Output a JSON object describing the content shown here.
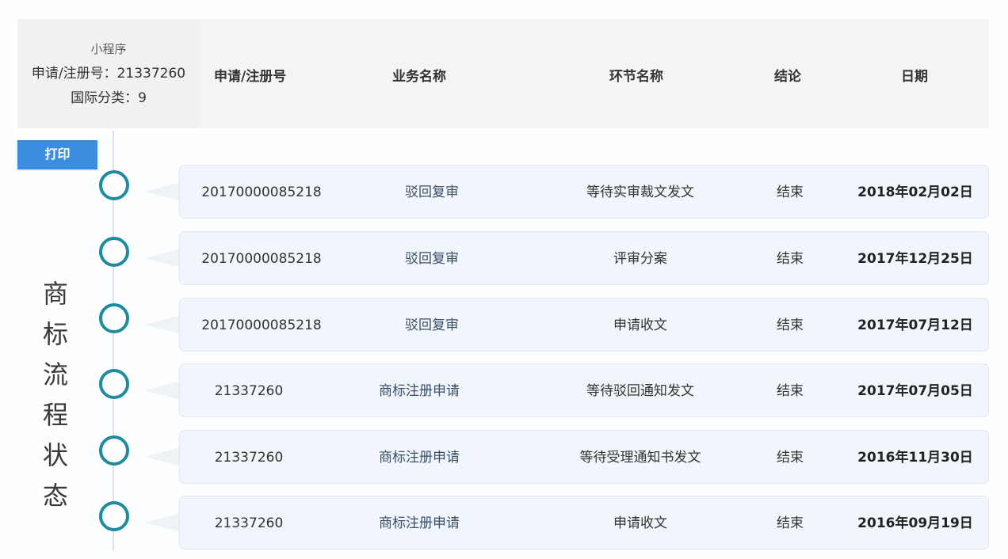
{
  "info": {
    "source": "小程序",
    "reg_line": "申请/注册号：21337260",
    "class_line": "国际分类：9"
  },
  "columns": {
    "reg_no": "申请/注册号",
    "business": "业务名称",
    "step": "环节名称",
    "result": "结论",
    "date": "日期"
  },
  "print_label": "打印",
  "vertical_title": [
    "商",
    "标",
    "流",
    "程",
    "状",
    "态"
  ],
  "rows": [
    {
      "reg_no": "20170000085218",
      "business": "驳回复审",
      "step": "等待实审裁文发文",
      "result": "结束",
      "date": "2018年02月02日"
    },
    {
      "reg_no": "20170000085218",
      "business": "驳回复审",
      "step": "评审分案",
      "result": "结束",
      "date": "2017年12月25日"
    },
    {
      "reg_no": "20170000085218",
      "business": "驳回复审",
      "step": "申请收文",
      "result": "结束",
      "date": "2017年07月12日"
    },
    {
      "reg_no": "21337260",
      "business": "商标注册申请",
      "step": "等待驳回通知发文",
      "result": "结束",
      "date": "2017年07月05日"
    },
    {
      "reg_no": "21337260",
      "business": "商标注册申请",
      "step": "等待受理通知书发文",
      "result": "结束",
      "date": "2016年11月30日"
    },
    {
      "reg_no": "21337260",
      "business": "商标注册申请",
      "step": "申请收文",
      "result": "结束",
      "date": "2016年09月19日"
    }
  ],
  "colors": {
    "accent": "#1e8c9e",
    "button": "#3b8de0",
    "card_bg": "#f0f6fb",
    "header_bg": "#f3f4f6"
  }
}
